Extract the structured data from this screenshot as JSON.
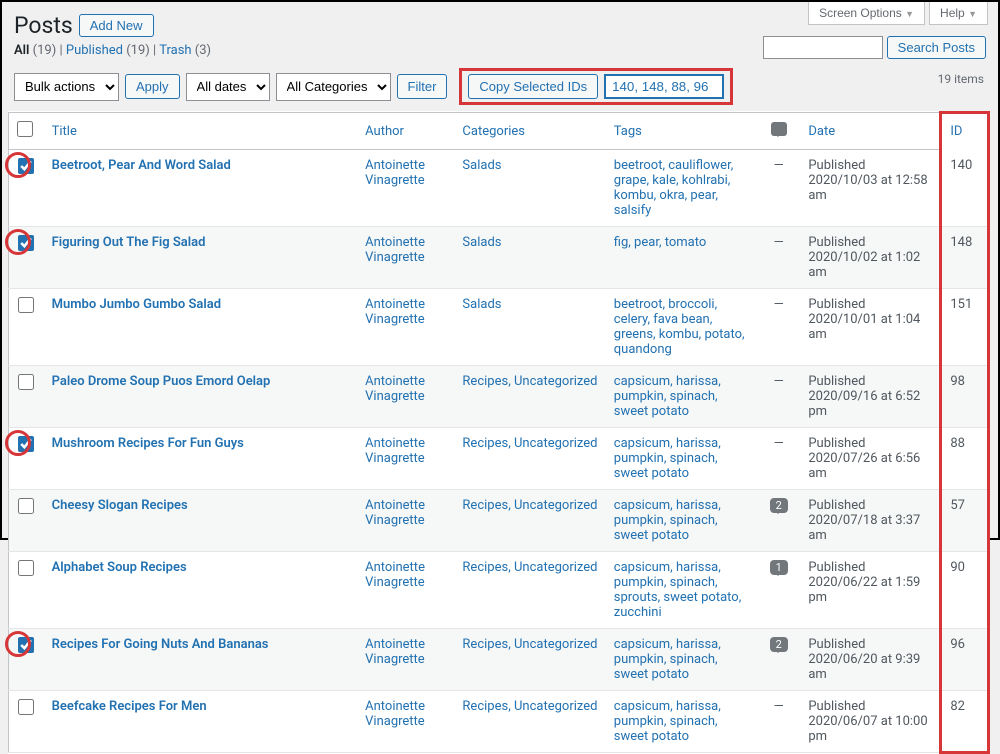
{
  "topTabs": {
    "screen": "Screen Options",
    "help": "Help"
  },
  "header": {
    "title": "Posts",
    "addNew": "Add New"
  },
  "views": {
    "all": "All",
    "allCount": "(19)",
    "published": "Published",
    "publishedCount": "(19)",
    "trash": "Trash",
    "trashCount": "(3)"
  },
  "search": {
    "button": "Search Posts"
  },
  "filters": {
    "bulk": "Bulk actions",
    "apply": "Apply",
    "dates": "All dates",
    "categories": "All Categories",
    "filter": "Filter",
    "copyIds": "Copy Selected IDs",
    "idsValue": "140, 148, 88, 96"
  },
  "itemsCount": "19 items",
  "columns": {
    "title": "Title",
    "author": "Author",
    "categories": "Categories",
    "tags": "Tags",
    "date": "Date",
    "id": "ID"
  },
  "rows": [
    {
      "checked": true,
      "circled": true,
      "title": "Beetroot, Pear And Word Salad",
      "author": "Antoinette Vinagrette",
      "categories": "Salads",
      "tags": "beetroot, cauliflower, grape, kale, kohlrabi, kombu, okra, pear, salsify",
      "comments": "—",
      "status": "Published",
      "date": "2020/10/03 at 12:58 am",
      "id": "140"
    },
    {
      "checked": true,
      "circled": true,
      "title": "Figuring Out The Fig Salad",
      "author": "Antoinette Vinagrette",
      "categories": "Salads",
      "tags": "fig, pear, tomato",
      "comments": "—",
      "status": "Published",
      "date": "2020/10/02 at 1:02 am",
      "id": "148"
    },
    {
      "checked": false,
      "circled": false,
      "title": "Mumbo Jumbo Gumbo Salad",
      "author": "Antoinette Vinagrette",
      "categories": "Salads",
      "tags": "beetroot, broccoli, celery, fava bean, greens, kombu, potato, quandong",
      "comments": "—",
      "status": "Published",
      "date": "2020/10/01 at 1:04 am",
      "id": "151"
    },
    {
      "checked": false,
      "circled": false,
      "title": "Paleo Drome Soup Puos Emord Oelap",
      "author": "Antoinette Vinagrette",
      "categories": "Recipes, Uncategorized",
      "tags": "capsicum, harissa, pumpkin, spinach, sweet potato",
      "comments": "—",
      "status": "Published",
      "date": "2020/09/16 at 6:52 pm",
      "id": "98"
    },
    {
      "checked": true,
      "circled": true,
      "title": "Mushroom Recipes For Fun Guys",
      "author": "Antoinette Vinagrette",
      "categories": "Recipes, Uncategorized",
      "tags": "capsicum, harissa, pumpkin, spinach, sweet potato",
      "comments": "—",
      "status": "Published",
      "date": "2020/07/26 at 6:56 am",
      "id": "88"
    },
    {
      "checked": false,
      "circled": false,
      "title": "Cheesy Slogan Recipes",
      "author": "Antoinette Vinagrette",
      "categories": "Recipes, Uncategorized",
      "tags": "capsicum, harissa, pumpkin, spinach, sweet potato",
      "comments": "2",
      "status": "Published",
      "date": "2020/07/18 at 3:37 am",
      "id": "57"
    },
    {
      "checked": false,
      "circled": false,
      "title": "Alphabet Soup Recipes",
      "author": "Antoinette Vinagrette",
      "categories": "Recipes, Uncategorized",
      "tags": "capsicum, harissa, pumpkin, spinach, sprouts, sweet potato, zucchini",
      "comments": "1",
      "status": "Published",
      "date": "2020/06/22 at 1:59 pm",
      "id": "90"
    },
    {
      "checked": true,
      "circled": true,
      "title": "Recipes For Going Nuts And Bananas",
      "author": "Antoinette Vinagrette",
      "categories": "Recipes, Uncategorized",
      "tags": "capsicum, harissa, pumpkin, spinach, sweet potato",
      "comments": "2",
      "status": "Published",
      "date": "2020/06/20 at 9:39 am",
      "id": "96"
    },
    {
      "checked": false,
      "circled": false,
      "title": "Beefcake Recipes For Men",
      "author": "Antoinette Vinagrette",
      "categories": "Recipes, Uncategorized",
      "tags": "capsicum, harissa, pumpkin, spinach, sweet potato",
      "comments": "—",
      "status": "Published",
      "date": "2020/06/07 at 10:00 pm",
      "id": "82"
    }
  ]
}
